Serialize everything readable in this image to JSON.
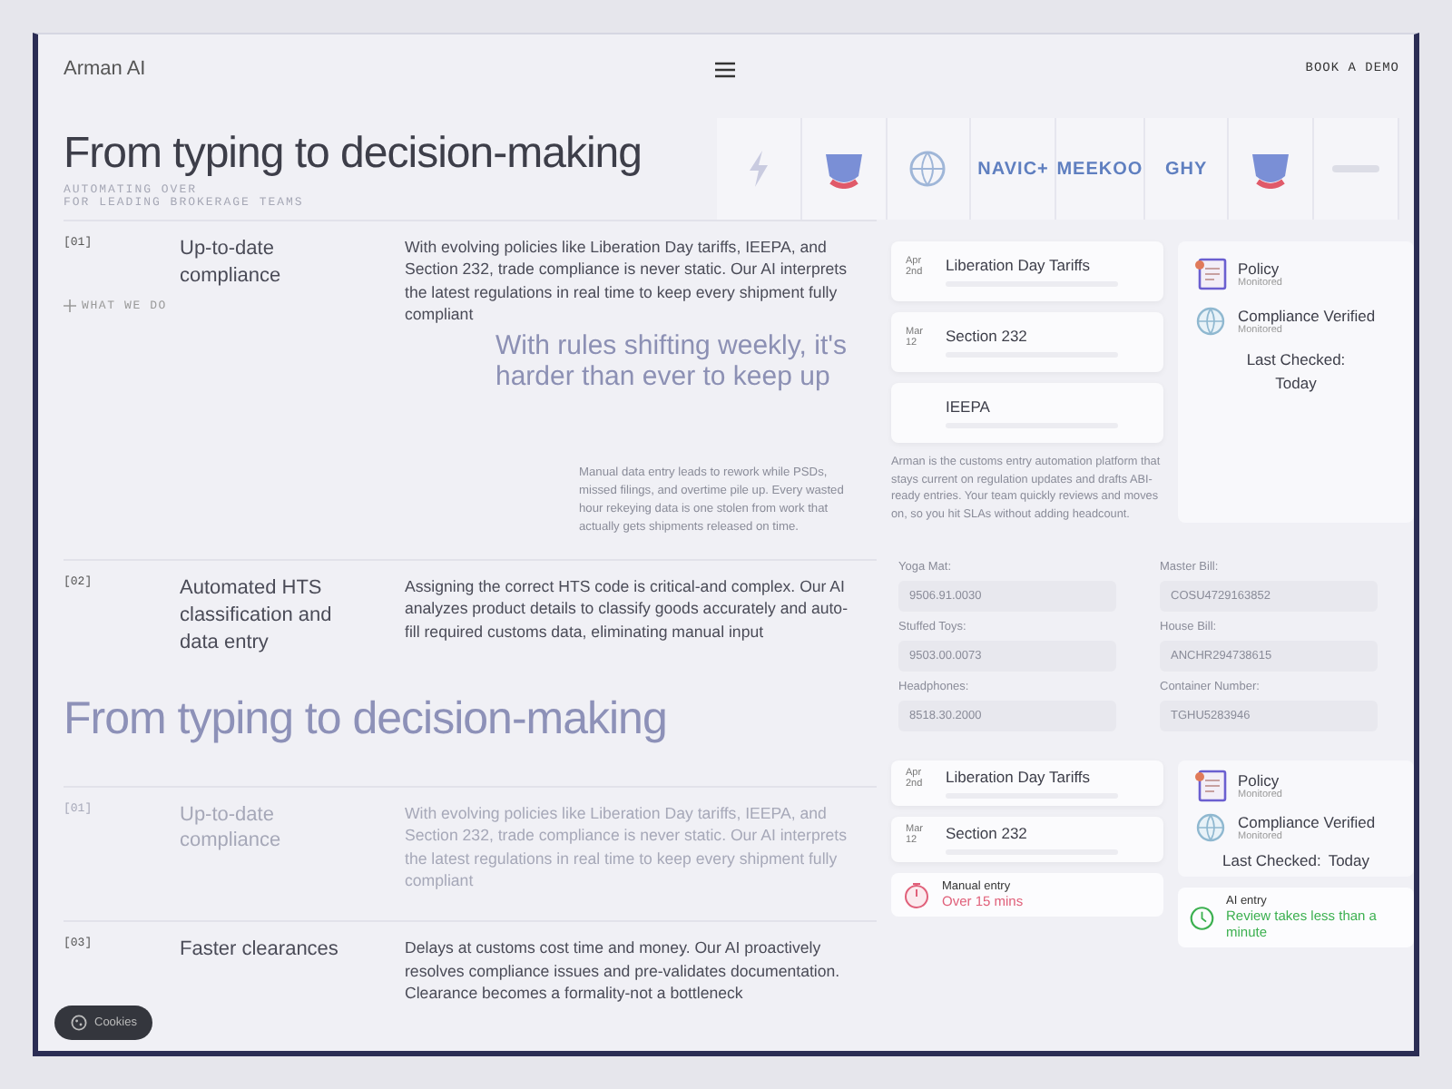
{
  "header": {
    "logo": "Arman AI",
    "cta": "BOOK A DEMO"
  },
  "hero": {
    "title": "From typing to decision-making",
    "subtitle": [
      "AUTOMATING OVER",
      "FOR LEADING BROKERAGE TEAMS"
    ],
    "logos": [
      {
        "kind": "bolt"
      },
      {
        "kind": "shield"
      },
      {
        "kind": "globe"
      },
      {
        "kind": "wordmark",
        "text": "NAVIC+"
      },
      {
        "kind": "wordmark",
        "text": "MEEKOO"
      },
      {
        "kind": "wordmark",
        "text": "GHY"
      },
      {
        "kind": "shield"
      },
      {
        "kind": "faint"
      }
    ]
  },
  "section_label": "WHAT WE DO",
  "features_top": [
    {
      "number": "[01]",
      "title": "Up-to-date compliance",
      "text": "With evolving policies like Liberation Day tariffs, IEEPA, and Section 232, trade compliance is never static. Our AI interprets the latest regulations in real time to keep every shipment fully compliant",
      "faded": false
    },
    {
      "number": "[02]",
      "title": "Automated HTS classification and data entry",
      "text": "Assigning the correct HTS code is critical-and complex. Our AI analyzes product details to classify goods accurately and auto-fill required customs data, eliminating manual input",
      "faded": false
    }
  ],
  "overlay": {
    "headline": "With rules shifting weekly, it's harder than ever to keep up",
    "text": "Manual data entry leads to rework while PSDs, missed filings, and overtime pile up. Every wasted hour rekeying data is one stolen from work that actually gets shipments released on time."
  },
  "heading_2": "From typing to decision-making",
  "features_bottom": [
    {
      "number": "[01]",
      "title": "Up-to-date compliance",
      "text": "With evolving policies like Liberation Day tariffs, IEEPA, and Section 232, trade compliance is never static. Our AI interprets the latest regulations in real time to keep every shipment fully compliant",
      "faded": true
    },
    {
      "number": "[03]",
      "title": "Faster clearances",
      "text": "Delays at customs cost time and money. Our AI proactively resolves compliance issues and pre-validates documentation. Clearance becomes a formality-not a bottleneck",
      "faded": false
    }
  ],
  "regulations": [
    {
      "month": "Apr",
      "day": "2nd",
      "title": "Liberation Day Tariffs"
    },
    {
      "month": "Mar",
      "day": "12",
      "title": "Section 232"
    },
    {
      "title": "IEEPA"
    }
  ],
  "status": {
    "items": [
      {
        "kind": "document",
        "title": "Policy",
        "note": "Monitored"
      },
      {
        "kind": "globe",
        "title": "Compliance Verified",
        "note": "Monitored"
      }
    ],
    "checked_label": "Last Checked:",
    "checked_value": "Today"
  },
  "about": "Arman is the customs entry automation platform that stays current on regulation updates and drafts ABI-ready entries. Your team quickly reviews and moves on, so you hit SLAs without adding headcount.",
  "form": {
    "columns": [
      [
        {
          "label": "Yoga Mat:",
          "value": "9506.91.0030"
        },
        {
          "label": "Stuffed Toys:",
          "value": "9503.00.0073"
        },
        {
          "label": "Headphones:",
          "value": "8518.30.2000"
        }
      ],
      [
        {
          "label": "Master Bill:",
          "value": "COSU4729163852"
        },
        {
          "label": "House Bill:",
          "value": "ANCHR294738615"
        },
        {
          "label": "Container Number:",
          "value": "TGHU5283946"
        }
      ]
    ]
  },
  "regulations_2": [
    {
      "month": "Apr",
      "day": "2nd",
      "title": "Liberation Day Tariffs"
    },
    {
      "month": "Mar",
      "day": "12",
      "title": "Section 232"
    }
  ],
  "status_2": {
    "items": [
      {
        "kind": "document",
        "title": "Policy",
        "note": "Monitored"
      },
      {
        "kind": "globe",
        "title": "Compliance Verified",
        "note": "Monitored"
      }
    ],
    "checked_label": "Last Checked:",
    "checked_value": "Today"
  },
  "comparison": [
    {
      "kind": "manual",
      "title": "Manual entry",
      "text": "Over 15 mins"
    },
    {
      "kind": "ai",
      "title": "AI entry",
      "text": "Review takes less than a minute"
    }
  ],
  "cookies": "Cookies"
}
